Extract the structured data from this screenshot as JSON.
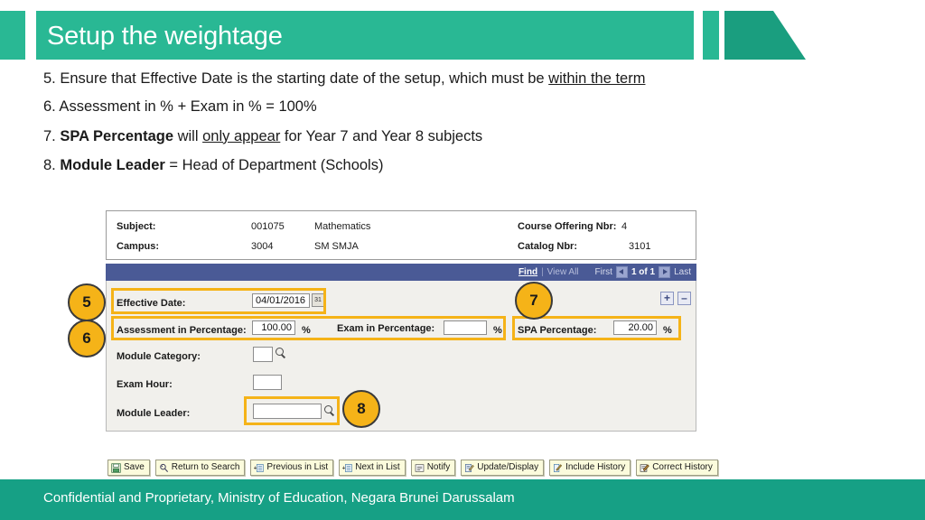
{
  "slide": {
    "title": "Setup the weightage",
    "accent_green": "#29b894",
    "accent_green_dark": "#1a9e7f",
    "footer_green": "#16a085",
    "callout_yellow": "#f5b318"
  },
  "bullets": [
    {
      "id": "bullet-5",
      "parts": [
        {
          "text": "5. Ensure that Effective Date is the starting date of the setup, which must be ",
          "style": "plain"
        },
        {
          "text": "within the term",
          "style": "underline"
        }
      ],
      "plain": "5. Ensure that Effective Date is the starting date of the setup, which must be within the term"
    },
    {
      "id": "bullet-6",
      "parts": [
        {
          "text": "6. Assessment in % + Exam in % = 100%",
          "style": "plain"
        }
      ],
      "plain": "6. Assessment in % + Exam in % = 100%"
    },
    {
      "id": "bullet-7",
      "parts": [
        {
          "text": "7. ",
          "style": "plain"
        },
        {
          "text": "SPA Percentage",
          "style": "bold"
        },
        {
          "text": " will ",
          "style": "plain"
        },
        {
          "text": "only appear",
          "style": "underline"
        },
        {
          "text": " for Year 7 and Year 8 subjects",
          "style": "plain"
        }
      ],
      "plain": "7. SPA Percentage will only appear for Year 7 and Year 8 subjects"
    },
    {
      "id": "bullet-8",
      "parts": [
        {
          "text": "8. ",
          "style": "plain"
        },
        {
          "text": "Module Leader",
          "style": "bold"
        },
        {
          "text": " = Head of Department (Schools)",
          "style": "plain"
        }
      ],
      "plain": "8. Module Leader = Head of Department (Schools)"
    }
  ],
  "app": {
    "info": {
      "subject_label": "Subject:",
      "subject_code": "001075",
      "subject_name": "Mathematics",
      "course_offering_label": "Course Offering Nbr:",
      "course_offering_value": "4",
      "campus_label": "Campus:",
      "campus_code": "3004",
      "campus_name": "SM SMJA",
      "catalog_label": "Catalog Nbr:",
      "catalog_value": "3101"
    },
    "nav": {
      "find": "Find",
      "separator": "|",
      "view_all": "View All",
      "first": "First",
      "count": "1 of 1",
      "last": "Last"
    },
    "fields": {
      "effective_date_label": "Effective Date:",
      "effective_date_value": "04/01/2016",
      "calendar_icon_glyph": "31",
      "assessment_label": "Assessment in Percentage:",
      "assessment_value": "100.00",
      "exam_label": "Exam in Percentage:",
      "exam_value": "",
      "spa_label": "SPA Percentage:",
      "spa_value": "20.00",
      "percent_sign": "%",
      "module_category_label": "Module Category:",
      "module_category_value": "",
      "exam_hour_label": "Exam Hour:",
      "exam_hour_value": "",
      "module_leader_label": "Module Leader:",
      "module_leader_value": ""
    },
    "row_buttons": {
      "add_label": "+",
      "delete_label": "–"
    },
    "toolbar": [
      {
        "label": "Save",
        "icon": "save-icon"
      },
      {
        "label": "Return to Search",
        "icon": "search-icon"
      },
      {
        "label": "Previous in List",
        "icon": "previous-icon"
      },
      {
        "label": "Next in List",
        "icon": "next-icon"
      },
      {
        "label": "Notify",
        "icon": "notify-icon"
      },
      {
        "label": "Update/Display",
        "icon": "update-display-icon"
      },
      {
        "label": "Include History",
        "icon": "include-history-icon"
      },
      {
        "label": "Correct History",
        "icon": "correct-history-icon"
      }
    ]
  },
  "callouts": [
    {
      "number": "5",
      "target": "effective-date-row"
    },
    {
      "number": "6",
      "target": "assessment-percentage-row"
    },
    {
      "number": "7",
      "target": "spa-percentage-field"
    },
    {
      "number": "8",
      "target": "module-leader-field"
    }
  ],
  "footer": {
    "text": "Confidential and Proprietary, Ministry of Education, Negara Brunei Darussalam"
  }
}
